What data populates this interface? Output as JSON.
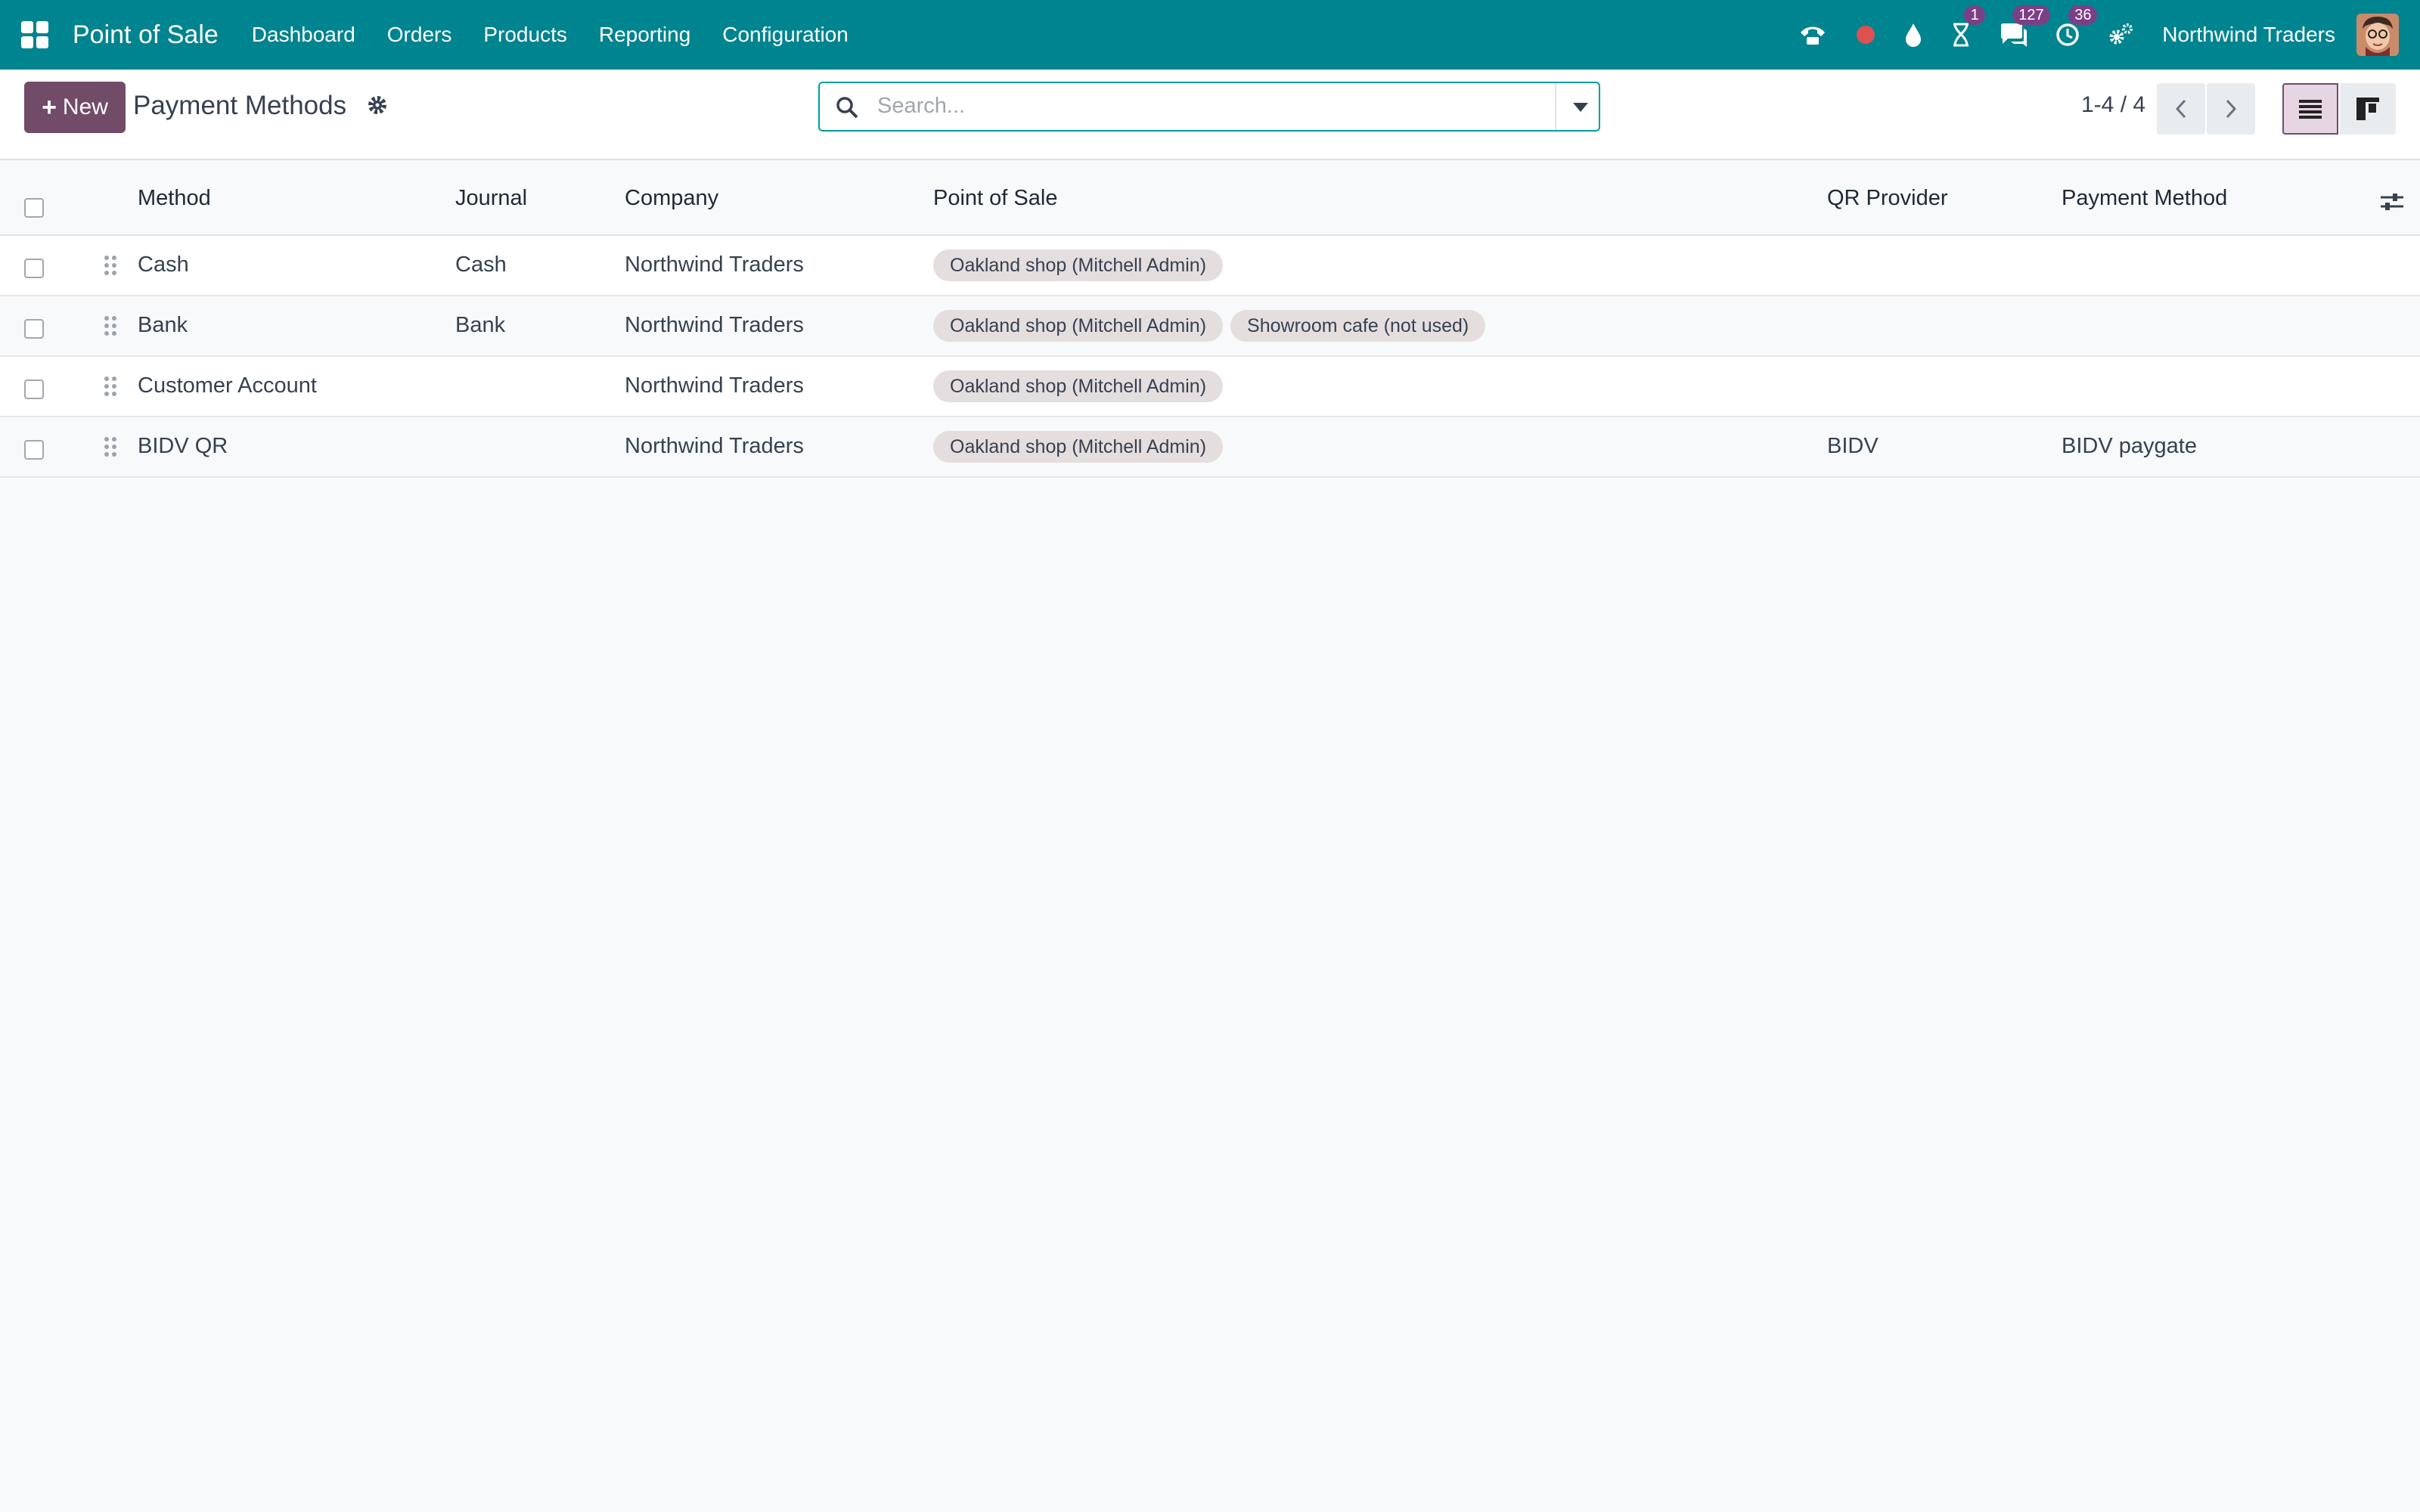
{
  "topbar": {
    "app_name": "Point of Sale",
    "menu": [
      "Dashboard",
      "Orders",
      "Products",
      "Reporting",
      "Configuration"
    ],
    "badges": {
      "activities": "1",
      "messages": "127",
      "clock": "36"
    },
    "company": "Northwind Traders",
    "colors": {
      "bar": "#00848f",
      "badge": "#7b3f86",
      "recording_dot": "#e05050"
    }
  },
  "control": {
    "new_label": "New",
    "title": "Payment Methods",
    "search_placeholder": "Search...",
    "pager": "1-4 / 4",
    "accent": "#714b67"
  },
  "table": {
    "columns": [
      "Method",
      "Journal",
      "Company",
      "Point of Sale",
      "QR Provider",
      "Payment Method"
    ],
    "rows": [
      {
        "method": "Cash",
        "journal": "Cash",
        "company": "Northwind Traders",
        "pos": [
          "Oakland shop (Mitchell Admin)"
        ],
        "qr_provider": "",
        "payment_method": ""
      },
      {
        "method": "Bank",
        "journal": "Bank",
        "company": "Northwind Traders",
        "pos": [
          "Oakland shop (Mitchell Admin)",
          "Showroom cafe (not used)"
        ],
        "qr_provider": "",
        "payment_method": ""
      },
      {
        "method": "Customer Account",
        "journal": "",
        "company": "Northwind Traders",
        "pos": [
          "Oakland shop (Mitchell Admin)"
        ],
        "qr_provider": "",
        "payment_method": ""
      },
      {
        "method": "BIDV QR",
        "journal": "",
        "company": "Northwind Traders",
        "pos": [
          "Oakland shop (Mitchell Admin)"
        ],
        "qr_provider": "BIDV",
        "payment_method": "BIDV paygate"
      }
    ]
  }
}
